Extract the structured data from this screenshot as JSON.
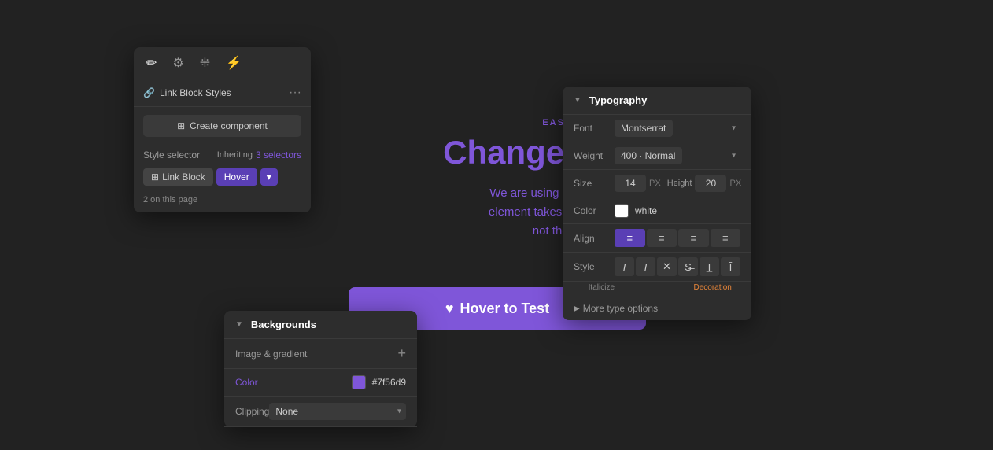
{
  "canvas": {
    "label": "EASY TO CREATE",
    "title": "Change SVG Color",
    "body": "We are using SVG code within an emb\nelement takes on the color of the paren\nnot the background co"
  },
  "hover_button": {
    "label": "Hover to Test",
    "heart": "♥"
  },
  "link_block_panel": {
    "title": "Link Block Styles",
    "create_component_label": "Create component",
    "style_selector_label": "Style selector",
    "inheriting_label": "Inheriting",
    "selectors_count": "3 selectors",
    "pill_link_block": "Link Block",
    "pill_hover": "Hover",
    "on_page": "2 on this page",
    "tabs": [
      "brush",
      "settings",
      "drops",
      "bolt"
    ]
  },
  "typography_panel": {
    "section_title": "Typography",
    "font_label": "Font",
    "font_value": "Montserrat",
    "weight_label": "Weight",
    "weight_value": "400 · Normal",
    "size_label": "Size",
    "size_value": "14",
    "size_unit": "PX",
    "height_label": "Height",
    "height_value": "20",
    "height_unit": "PX",
    "color_label": "Color",
    "color_name": "white",
    "align_label": "Align",
    "style_label": "Style",
    "italicize_label": "Italicize",
    "decoration_label": "Decoration",
    "more_type_label": "More type options"
  },
  "backgrounds_panel": {
    "section_title": "Backgrounds",
    "image_gradient_label": "Image & gradient",
    "color_label": "Color",
    "color_hex": "#7f56d9",
    "clipping_label": "Clipping",
    "clipping_value": "None"
  }
}
